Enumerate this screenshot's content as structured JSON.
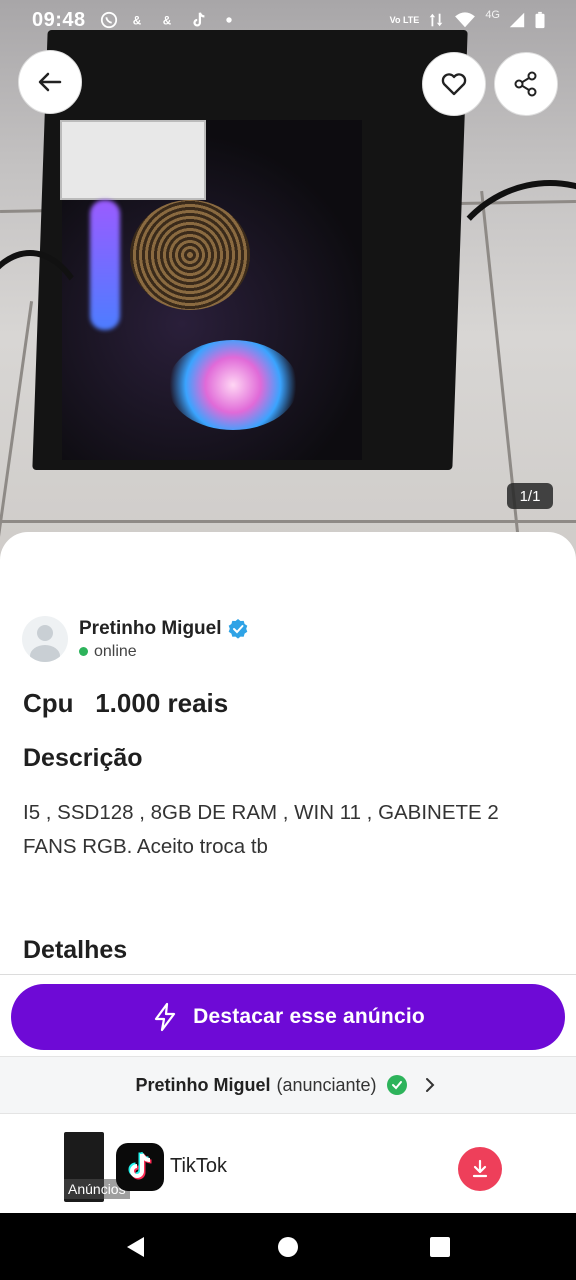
{
  "status_bar": {
    "time": "09:48",
    "network_label": "4G",
    "volte_label": "Vo LTE",
    "icons": [
      "whatsapp-icon",
      "app-icon",
      "app-icon",
      "tiktok-icon",
      "dot-icon",
      "wifi-icon",
      "signal-icon",
      "battery-icon"
    ]
  },
  "hero": {
    "image_counter": "1/1",
    "back_icon": "arrow-left-icon",
    "favorite_icon": "heart-icon",
    "share_icon": "share-icon"
  },
  "seller": {
    "name": "Pretinho Miguel",
    "status": "online",
    "verified": true
  },
  "listing": {
    "title": "Cpu   1.000 reais",
    "description_heading": "Descrição",
    "description": "I5 , SSD128 , 8GB DE RAM , WIN 11 , GABINETE 2 FANS RGB. Aceito troca tb",
    "details_heading": "Detalhes"
  },
  "promote": {
    "label": "Destacar esse anúncio",
    "icon": "lightning-icon"
  },
  "advertiser": {
    "name": "Pretinho Miguel",
    "role": "(anunciante)"
  },
  "ad_banner": {
    "label": "Anúncios",
    "app_name": "TikTok"
  },
  "colors": {
    "primary": "#6e0ad6",
    "online": "#2db35b",
    "verified": "#2fa3e6",
    "download": "#ee3f5a"
  }
}
